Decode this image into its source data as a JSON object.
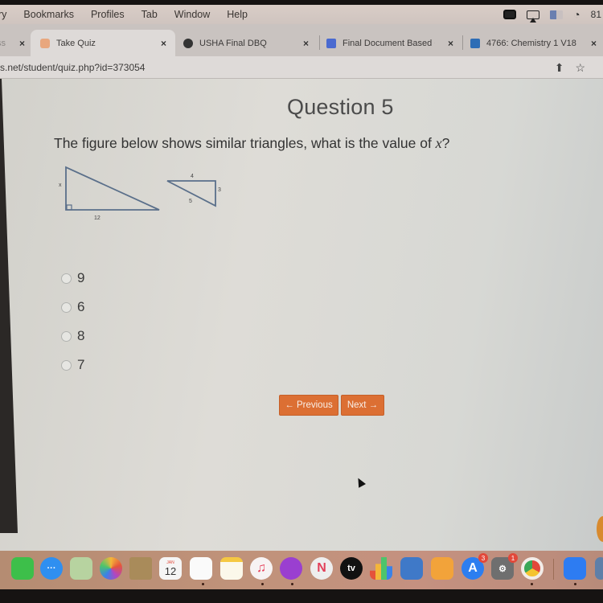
{
  "menubar": {
    "items": [
      "ry",
      "Bookmarks",
      "Profiles",
      "Tab",
      "Window",
      "Help"
    ],
    "clock": "81"
  },
  "tabs": [
    {
      "label": "ss",
      "active": false
    },
    {
      "label": "Take Quiz",
      "active": true
    },
    {
      "label": "USHA Final DBQ",
      "active": false
    },
    {
      "label": "Final Document Based Q...",
      "active": false
    },
    {
      "label": "4766: Chemistry 1 V18",
      "active": false
    }
  ],
  "address": {
    "url": "s.net/student/quiz.php?id=373054"
  },
  "quiz": {
    "title": "Question 5",
    "question_prefix": "The figure below shows similar triangles, what is the value of ",
    "question_var": "x",
    "question_suffix": "?",
    "figure": {
      "large_triangle": {
        "left_label": "x",
        "bottom_label": "12"
      },
      "small_triangle": {
        "top_label": "4",
        "right_label": "3",
        "hyp_label": "5"
      }
    },
    "options": [
      "9",
      "6",
      "8",
      "7"
    ],
    "selected": null,
    "prev_label": "← Previous",
    "next_label": "Next →"
  },
  "dock": {
    "apps": [
      {
        "name": "FaceTime"
      },
      {
        "name": "Messages"
      },
      {
        "name": "Maps"
      },
      {
        "name": "Photos"
      },
      {
        "name": "Contacts"
      },
      {
        "name": "Calendar",
        "text": "12",
        "month": "JAN"
      },
      {
        "name": "Reminders"
      },
      {
        "name": "Notes"
      },
      {
        "name": "Music"
      },
      {
        "name": "Podcasts"
      },
      {
        "name": "News"
      },
      {
        "name": "TV",
        "text": "tv"
      },
      {
        "name": "Numbers"
      },
      {
        "name": "Keynote"
      },
      {
        "name": "Pages"
      },
      {
        "name": "App Store",
        "badge": "3"
      },
      {
        "name": "System Preferences",
        "badge": "1"
      },
      {
        "name": "Chrome"
      },
      {
        "name": "Zoom"
      }
    ]
  },
  "colors": {
    "accent": "#dc6f33",
    "page_bg": "#dcdad5",
    "triangle_stroke": "#5a6f8a"
  }
}
